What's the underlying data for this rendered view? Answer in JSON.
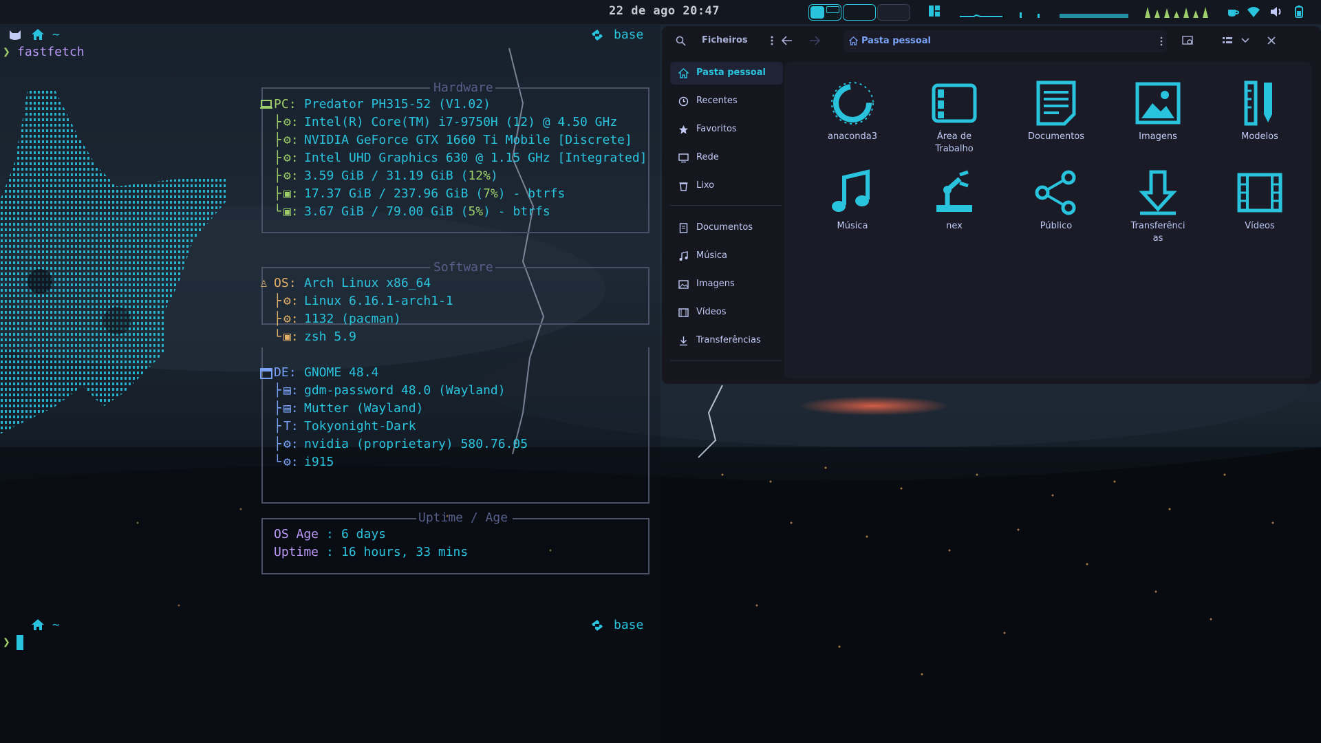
{
  "topbar": {
    "clock": "22 de ago 20:47"
  },
  "terminal": {
    "prompt_dir": "~",
    "env_label": "base",
    "command": "fastfetch",
    "sections": {
      "hardware": "Hardware",
      "software": "Software",
      "uptime": "Uptime / Age"
    },
    "hardware": {
      "key": "PC",
      "host": "Predator PH315-52 (V1.02)",
      "cpu": "Intel(R) Core(TM) i7-9750H (12) @ 4.50 GHz",
      "gpu1": "NVIDIA GeForce GTX 1660 Ti Mobile [Discrete]",
      "gpu2": "Intel UHD Graphics 630 @ 1.15 GHz [Integrated]",
      "mem_value": "3.59 GiB / 31.19 GiB",
      "mem_pct": "12%",
      "disk1_value": "17.37 GiB / 237.96 GiB",
      "disk1_pct": "7%",
      "disk1_fs": "btrfs",
      "disk2_value": "3.67 GiB / 79.00 GiB",
      "disk2_pct": "5%",
      "disk2_fs": "btrfs"
    },
    "software": {
      "key": "OS",
      "os": "Arch Linux x86_64",
      "kernel": "Linux 6.16.1-arch1-1",
      "packages": "1132 (pacman)",
      "shell": "zsh 5.9"
    },
    "desktop": {
      "key": "DE",
      "de": "GNOME 48.4",
      "lm": "gdm-password 48.0 (Wayland)",
      "wm": "Mutter (Wayland)",
      "theme": "Tokyonight-Dark",
      "driver1": "nvidia (proprietary) 580.76.05",
      "driver2": "i915"
    },
    "uptime": {
      "os_age_key": "OS Age",
      "os_age": "6 days",
      "uptime_key": "Uptime",
      "uptime": "16 hours, 33 mins"
    }
  },
  "files": {
    "title": "Ficheiros",
    "path": "Pasta pessoal",
    "sidebar": [
      {
        "label": "Pasta pessoal",
        "icon": "home-icon",
        "active": true
      },
      {
        "label": "Recentes",
        "icon": "clock-icon"
      },
      {
        "label": "Favoritos",
        "icon": "star-icon"
      },
      {
        "label": "Rede",
        "icon": "network-icon"
      },
      {
        "label": "Lixo",
        "icon": "trash-icon"
      },
      {
        "label": "Documentos",
        "icon": "document-icon"
      },
      {
        "label": "Música",
        "icon": "music-icon"
      },
      {
        "label": "Imagens",
        "icon": "image-icon"
      },
      {
        "label": "Vídeos",
        "icon": "video-icon"
      },
      {
        "label": "Transferências",
        "icon": "download-icon"
      }
    ],
    "folders": [
      {
        "name": "anaconda3",
        "icon": "anaconda-folder-icon"
      },
      {
        "name": "Área de\nTrabalho",
        "icon": "desktop-folder-icon"
      },
      {
        "name": "Documentos",
        "icon": "documents-folder-icon"
      },
      {
        "name": "Imagens",
        "icon": "pictures-folder-icon"
      },
      {
        "name": "Modelos",
        "icon": "templates-folder-icon"
      },
      {
        "name": "Música",
        "icon": "music-folder-icon"
      },
      {
        "name": "nex",
        "icon": "robot-arm-folder-icon"
      },
      {
        "name": "Público",
        "icon": "share-folder-icon"
      },
      {
        "name": "Transferênci\nas",
        "icon": "downloads-folder-icon"
      },
      {
        "name": "Vídeos",
        "icon": "videos-folder-icon"
      }
    ]
  }
}
